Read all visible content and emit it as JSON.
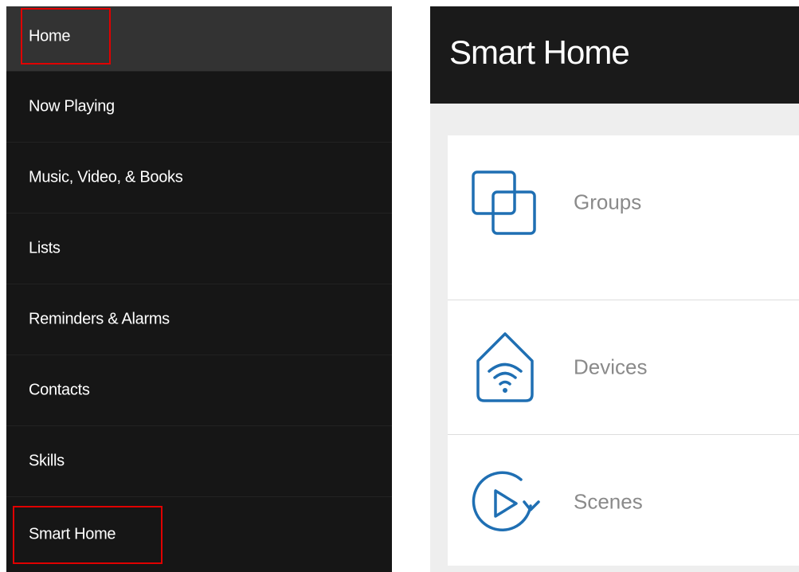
{
  "nav": {
    "items": [
      {
        "label": "Home"
      },
      {
        "label": "Now Playing"
      },
      {
        "label": "Music, Video, & Books"
      },
      {
        "label": "Lists"
      },
      {
        "label": "Reminders & Alarms"
      },
      {
        "label": "Contacts"
      },
      {
        "label": "Skills"
      },
      {
        "label": "Smart Home"
      }
    ]
  },
  "smart_home": {
    "title": "Smart Home",
    "options": [
      {
        "label": "Groups",
        "icon": "groups-icon"
      },
      {
        "label": "Devices",
        "icon": "devices-icon"
      },
      {
        "label": "Scenes",
        "icon": "scenes-icon"
      }
    ]
  },
  "colors": {
    "accent": "#1f6fb3",
    "highlight": "#e00000",
    "drawer_bg": "#161616",
    "header_bg": "#1a1a1a"
  }
}
